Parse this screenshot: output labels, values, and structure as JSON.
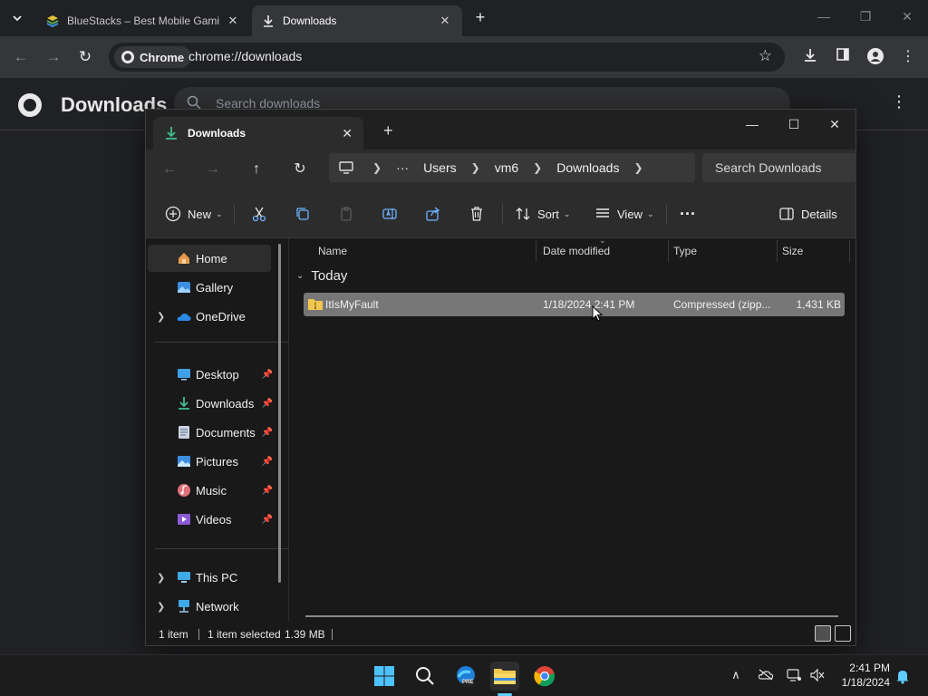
{
  "chrome": {
    "tabs": [
      {
        "title": "BlueStacks – Best Mobile Gaming Platform",
        "favicon": "bluestacks-icon",
        "active": false
      },
      {
        "title": "Downloads",
        "favicon": "download-icon",
        "active": true
      }
    ],
    "chip_label": "Chrome",
    "url": "chrome://downloads",
    "page_title": "Downloads",
    "search_placeholder": "Search downloads"
  },
  "explorer": {
    "tab_title": "Downloads",
    "breadcrumb": [
      "Users",
      "vm6",
      "Downloads"
    ],
    "search_placeholder": "Search Downloads",
    "commands": {
      "new": "New",
      "sort": "Sort",
      "view": "View",
      "details": "Details"
    },
    "nav": [
      {
        "label": "Home",
        "icon": "home-icon"
      },
      {
        "label": "Gallery",
        "icon": "gallery-icon"
      },
      {
        "label": "OneDrive",
        "icon": "onedrive-icon"
      },
      {
        "label": "Desktop",
        "icon": "desktop-icon"
      },
      {
        "label": "Downloads",
        "icon": "download-icon"
      },
      {
        "label": "Documents",
        "icon": "documents-icon"
      },
      {
        "label": "Pictures",
        "icon": "pictures-icon"
      },
      {
        "label": "Music",
        "icon": "music-icon"
      },
      {
        "label": "Videos",
        "icon": "videos-icon"
      },
      {
        "label": "This PC",
        "icon": "this-pc-icon"
      },
      {
        "label": "Network",
        "icon": "network-icon"
      }
    ],
    "columns": {
      "name": "Name",
      "date": "Date modified",
      "type": "Type",
      "size": "Size"
    },
    "group": "Today",
    "files": [
      {
        "name": "ItIsMyFault",
        "date": "1/18/2024 2:41 PM",
        "type": "Compressed (zipp...",
        "size": "1,431 KB"
      }
    ],
    "status": {
      "count": "1 item",
      "selected": "1 item selected",
      "size": "1.39 MB"
    }
  },
  "taskbar": {
    "time": "2:41 PM",
    "date": "1/18/2024",
    "edge_badge": "PRE"
  },
  "colors": {
    "accent": "#60cdff",
    "selection": "#777777",
    "folder": "#f2c74e"
  }
}
